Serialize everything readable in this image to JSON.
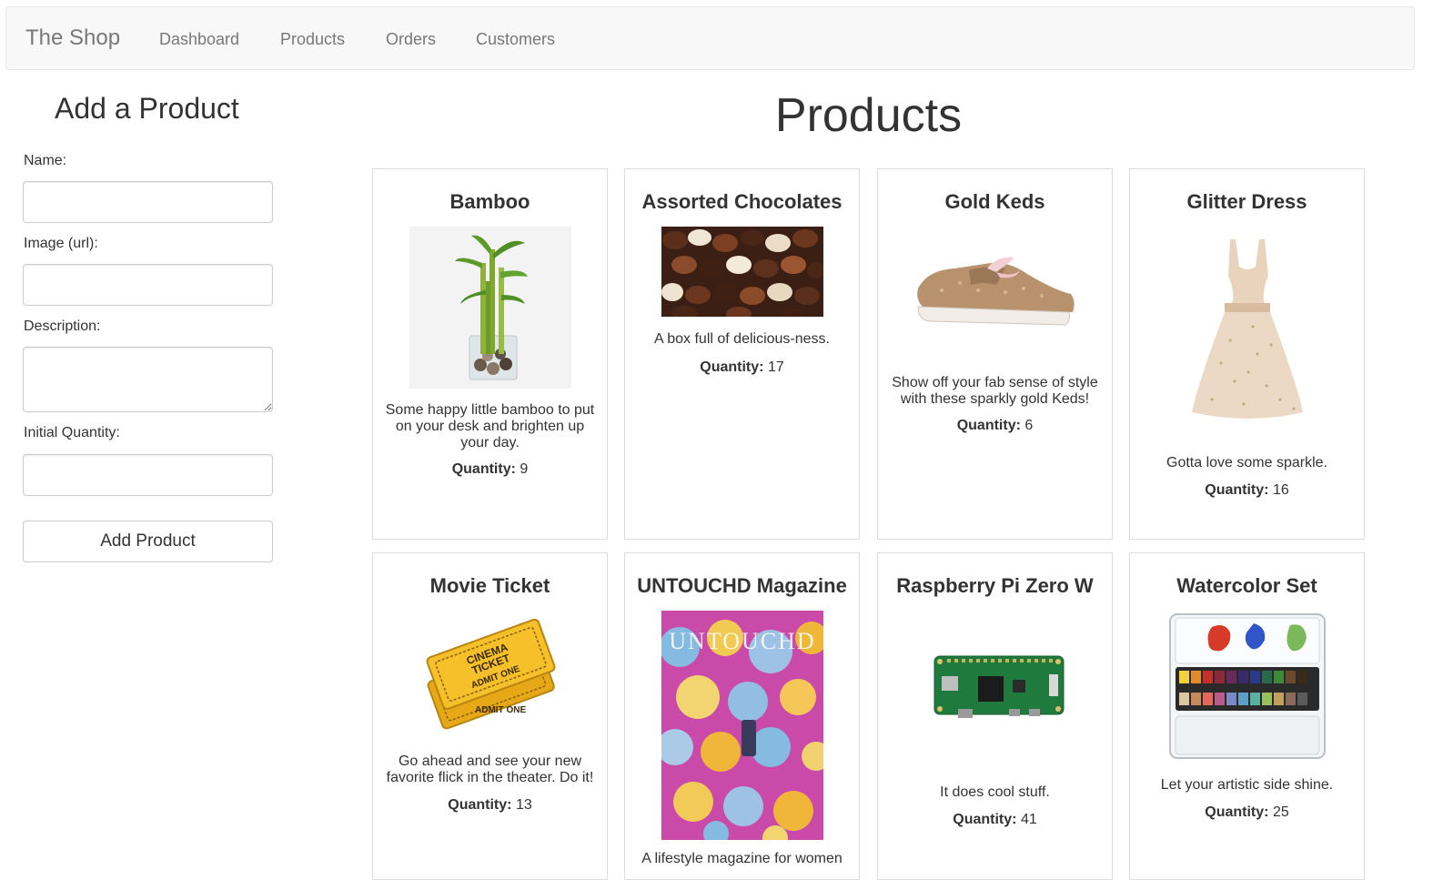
{
  "nav": {
    "brand": "The Shop",
    "links": [
      "Dashboard",
      "Products",
      "Orders",
      "Customers"
    ]
  },
  "form": {
    "title": "Add a Product",
    "name_label": "Name:",
    "image_label": "Image (url):",
    "description_label": "Description:",
    "quantity_label": "Initial Quantity:",
    "name_value": "",
    "image_value": "",
    "description_value": "",
    "quantity_value": "",
    "submit_label": "Add Product"
  },
  "products": {
    "title": "Products",
    "quantity_label": "Quantity:",
    "items": [
      {
        "name": "Bamboo",
        "description": "Some happy little bamboo to put on your desk and brighten up your day.",
        "quantity": "9",
        "icon": "bamboo-image"
      },
      {
        "name": "Assorted Chocolates",
        "description": "A box full of delicious-ness.",
        "quantity": "17",
        "icon": "chocolates-image"
      },
      {
        "name": "Gold Keds",
        "description": "Show off your fab sense of style with these sparkly gold Keds!",
        "quantity": "6",
        "icon": "sneaker-image"
      },
      {
        "name": "Glitter Dress",
        "description": "Gotta love some sparkle.",
        "quantity": "16",
        "icon": "dress-image"
      },
      {
        "name": "Movie Ticket",
        "description": "Go ahead and see your new favorite flick in the theater. Do it!",
        "quantity": "13",
        "icon": "ticket-image"
      },
      {
        "name": "UNTOUCHD Magazine",
        "description": "A lifestyle magazine for women",
        "quantity": "",
        "icon": "magazine-image"
      },
      {
        "name": "Raspberry Pi Zero W",
        "description": "It does cool stuff.",
        "quantity": "41",
        "icon": "circuit-board-image"
      },
      {
        "name": "Watercolor Set",
        "description": "Let your artistic side shine.",
        "quantity": "25",
        "icon": "paint-palette-image"
      }
    ]
  },
  "ticket_image": {
    "line1": "CINEMA",
    "line2": "TICKET",
    "line3": "ADMIT ONE",
    "line4": "ADMIT ONE"
  },
  "magazine_image": {
    "masthead": "UNTOUCHD"
  },
  "colors": {
    "navbar_bg": "#f8f8f8",
    "border": "#dddddd",
    "text": "#333333",
    "nav_text": "#777777"
  }
}
